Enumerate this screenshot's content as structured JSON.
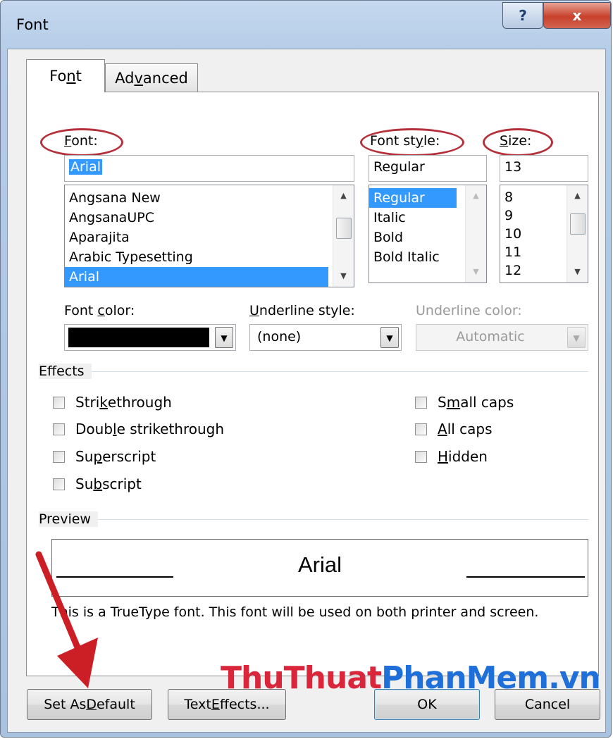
{
  "window": {
    "title": "Font",
    "help_glyph": "?",
    "close_glyph": "x"
  },
  "tabs": [
    {
      "pre": "Fo",
      "key": "n",
      "post": "t",
      "active": true
    },
    {
      "pre": "Ad",
      "key": "v",
      "post": "anced",
      "active": false
    }
  ],
  "font": {
    "label_key": "F",
    "label_rest": "ont:",
    "value": "Arial",
    "items": [
      "Angsana New",
      "AngsanaUPC",
      "Aparajita",
      "Arabic Typesetting",
      "Arial"
    ],
    "selected": "Arial"
  },
  "font_style": {
    "label_pre": "Font st",
    "label_key": "y",
    "label_post": "le:",
    "value": "Regular",
    "items": [
      "Regular",
      "Italic",
      "Bold",
      "Bold Italic"
    ],
    "selected": "Regular"
  },
  "size": {
    "label_key": "S",
    "label_rest": "ize:",
    "value": "13",
    "items": [
      "8",
      "9",
      "10",
      "11",
      "12"
    ]
  },
  "font_color": {
    "label_pre": "Font ",
    "label_key": "c",
    "label_post": "olor:",
    "value_color": "#000000"
  },
  "underline_style": {
    "label_key": "U",
    "label_rest": "nderline style:",
    "value": "(none)"
  },
  "underline_color": {
    "label": "Underline color:",
    "value": "Automatic"
  },
  "effects": {
    "title": "Effects",
    "left": [
      {
        "pre": "Stri",
        "key": "k",
        "post": "ethrough"
      },
      {
        "pre": "Doub",
        "key": "l",
        "post": "e strikethrough"
      },
      {
        "pre": "Su",
        "key": "p",
        "post": "erscript"
      },
      {
        "pre": "Su",
        "key": "b",
        "post": "script"
      }
    ],
    "right": [
      {
        "pre": "S",
        "key": "m",
        "post": "all caps"
      },
      {
        "pre": "",
        "key": "A",
        "post": "ll caps"
      },
      {
        "pre": "",
        "key": "H",
        "post": "idden"
      }
    ]
  },
  "preview": {
    "title": "Preview",
    "sample": "Arial",
    "info": "This is a TrueType font. This font will be used on both printer and screen."
  },
  "buttons": {
    "set_default": {
      "pre": "Set As ",
      "key": "D",
      "post": "efault"
    },
    "text_effects": {
      "pre": "Text ",
      "key": "E",
      "post": "ffects..."
    },
    "ok": "OK",
    "cancel": "Cancel"
  },
  "watermark": {
    "part1": "ThuThuat",
    "part2": "PhanMem",
    "part3": ".vn"
  },
  "colors": {
    "selection": "#3399ff",
    "annotation": "#b5303a",
    "watermark_red": "#d9263a",
    "watermark_blue": "#1e6fd9"
  }
}
